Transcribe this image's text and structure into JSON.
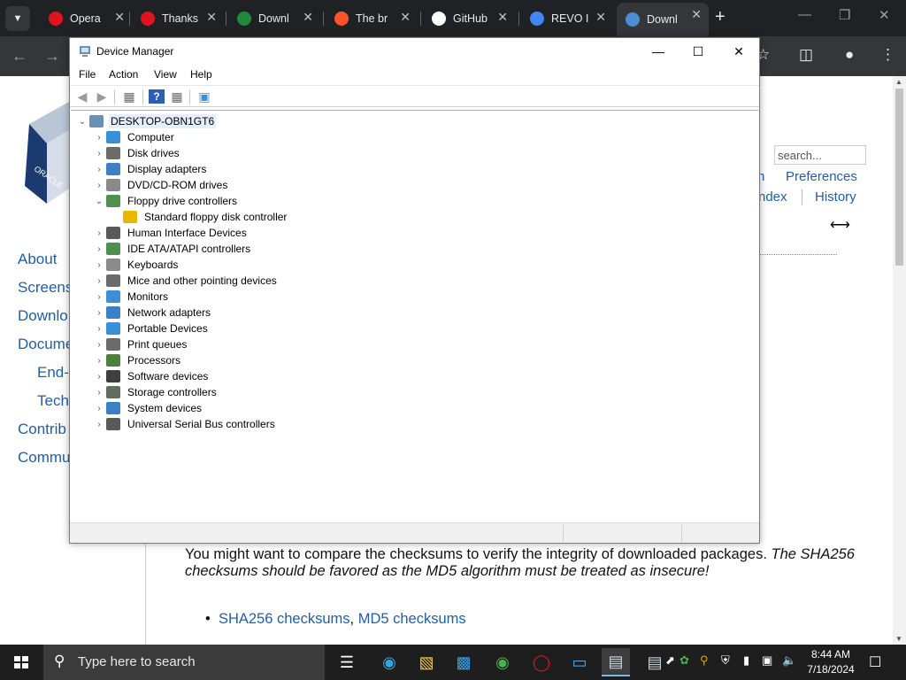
{
  "browser": {
    "tabs": [
      {
        "title": "Opera",
        "favicon": "opera-icon",
        "color": "#e0141e"
      },
      {
        "title": "Thanks",
        "favicon": "opera-gx-icon",
        "color": "#e0141e"
      },
      {
        "title": "Downl",
        "favicon": "play-triangle-icon",
        "color": "#1e8a3a"
      },
      {
        "title": "The br",
        "favicon": "brave-icon",
        "color": "#fb542b"
      },
      {
        "title": "GitHub",
        "favicon": "github-icon",
        "color": "#ffffff"
      },
      {
        "title": "REVO I",
        "favicon": "google-icon",
        "color": "#4285f4"
      },
      {
        "title": "Downl",
        "favicon": "virtualbox-icon",
        "color": "#4a8fd4",
        "active": true
      }
    ]
  },
  "webpage": {
    "search_placeholder": "search...",
    "top_links": [
      "n",
      "Preferences",
      "ndex",
      "History"
    ],
    "sidebar_links": [
      "About",
      "Screens",
      "Downlo",
      "Docume",
      "End-",
      "Tech",
      "Contrib",
      "Commu"
    ],
    "paragraph": "You might want to compare the checksums to verify the integrity of downloaded packages.",
    "paragraph_italic": "The SHA256 checksums should be favored as the MD5 algorithm must be treated as insecure!",
    "checksum_links": [
      "SHA256 checksums",
      "MD5 checksums"
    ],
    "checksum_sep": ", "
  },
  "device_manager": {
    "title": "Device Manager",
    "menu": [
      "File",
      "Action",
      "View",
      "Help"
    ],
    "root": "DESKTOP-OBN1GT6",
    "categories": [
      {
        "label": "Computer",
        "icon": "computer-icon",
        "color": "#3a8fd8"
      },
      {
        "label": "Disk drives",
        "icon": "disk-drive-icon",
        "color": "#6b6b6b"
      },
      {
        "label": "Display adapters",
        "icon": "display-adapter-icon",
        "color": "#3b7fc4"
      },
      {
        "label": "DVD/CD-ROM drives",
        "icon": "dvd-drive-icon",
        "color": "#8a8a8a"
      },
      {
        "label": "Floppy drive controllers",
        "icon": "controller-icon",
        "color": "#4f8f4f",
        "expanded": true,
        "children": [
          {
            "label": "Standard floppy disk controller",
            "icon": "warning-controller-icon",
            "color": "#e6b800"
          }
        ]
      },
      {
        "label": "Human Interface Devices",
        "icon": "hid-icon",
        "color": "#5a5a5a"
      },
      {
        "label": "IDE ATA/ATAPI controllers",
        "icon": "ide-controller-icon",
        "color": "#4f8f4f"
      },
      {
        "label": "Keyboards",
        "icon": "keyboard-icon",
        "color": "#8a8a8a"
      },
      {
        "label": "Mice and other pointing devices",
        "icon": "mouse-icon",
        "color": "#6b6b6b"
      },
      {
        "label": "Monitors",
        "icon": "monitor-icon",
        "color": "#3a8fd8"
      },
      {
        "label": "Network adapters",
        "icon": "network-adapter-icon",
        "color": "#3b7fc4"
      },
      {
        "label": "Portable Devices",
        "icon": "portable-device-icon",
        "color": "#3a8fd8"
      },
      {
        "label": "Print queues",
        "icon": "printer-icon",
        "color": "#6b6b6b"
      },
      {
        "label": "Processors",
        "icon": "processor-icon",
        "color": "#4f7f3f"
      },
      {
        "label": "Software devices",
        "icon": "software-device-icon",
        "color": "#3f3f3f"
      },
      {
        "label": "Storage controllers",
        "icon": "storage-controller-icon",
        "color": "#5f6f5f"
      },
      {
        "label": "System devices",
        "icon": "system-device-icon",
        "color": "#3b7fc4"
      },
      {
        "label": "Universal Serial Bus controllers",
        "icon": "usb-icon",
        "color": "#5a5a5a"
      }
    ]
  },
  "taskbar": {
    "search_placeholder": "Type here to search",
    "time": "8:44 AM",
    "date": "7/18/2024"
  }
}
